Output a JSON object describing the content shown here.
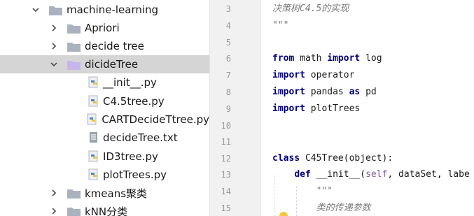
{
  "project_tree": {
    "items": [
      {
        "label": "machine-learning",
        "expanded": true,
        "type": "folder"
      },
      {
        "label": "Apriori",
        "expanded": false,
        "type": "folder"
      },
      {
        "label": "decide tree",
        "expanded": false,
        "type": "folder"
      },
      {
        "label": "dicideTree",
        "expanded": true,
        "type": "folder",
        "selected": true
      },
      {
        "label": "__init__.py",
        "type": "python-file"
      },
      {
        "label": "C4.5tree.py",
        "type": "python-file"
      },
      {
        "label": "CARTDecideTtree.py",
        "type": "python-file"
      },
      {
        "label": "decideTree.txt",
        "type": "text-file"
      },
      {
        "label": "ID3tree.py",
        "type": "python-file"
      },
      {
        "label": "plotTrees.py",
        "type": "python-file"
      },
      {
        "label": "kmeans聚类",
        "expanded": false,
        "type": "folder"
      },
      {
        "label": "kNN分类",
        "expanded": false,
        "type": "folder"
      }
    ]
  },
  "editor": {
    "line_numbers": [
      "3",
      "4",
      "5",
      "6",
      "7",
      "8",
      "9",
      "10",
      "11",
      "12",
      "13",
      "14",
      "15"
    ],
    "lines": [
      {
        "n": "3",
        "parts": [
          {
            "t": "决策树C4.5的实现",
            "s": "doc"
          }
        ]
      },
      {
        "n": "4",
        "parts": [
          {
            "t": "\"\"\"",
            "s": "doc"
          }
        ]
      },
      {
        "n": "5",
        "parts": []
      },
      {
        "n": "6",
        "parts": [
          {
            "t": "from",
            "s": "kw"
          },
          {
            "t": " math ",
            "s": ""
          },
          {
            "t": "import",
            "s": "kw"
          },
          {
            "t": " log",
            "s": ""
          }
        ]
      },
      {
        "n": "7",
        "parts": [
          {
            "t": "import",
            "s": "kw"
          },
          {
            "t": " operator",
            "s": ""
          }
        ]
      },
      {
        "n": "8",
        "parts": [
          {
            "t": "import",
            "s": "kw"
          },
          {
            "t": " pandas ",
            "s": ""
          },
          {
            "t": "as",
            "s": "kw"
          },
          {
            "t": " pd",
            "s": ""
          }
        ]
      },
      {
        "n": "9",
        "parts": [
          {
            "t": "import",
            "s": "kw"
          },
          {
            "t": " plotTrees",
            "s": ""
          }
        ]
      },
      {
        "n": "10",
        "parts": []
      },
      {
        "n": "11",
        "parts": []
      },
      {
        "n": "12",
        "parts": [
          {
            "t": "class",
            "s": "kw"
          },
          {
            "t": " C45Tree(object):",
            "s": ""
          }
        ]
      },
      {
        "n": "13",
        "parts": [
          {
            "t": "    ",
            "s": ""
          },
          {
            "t": "def",
            "s": "kw"
          },
          {
            "t": " __init__(",
            "s": ""
          },
          {
            "t": "self",
            "s": "slf"
          },
          {
            "t": ", dataSet, labe",
            "s": ""
          }
        ]
      },
      {
        "n": "14",
        "parts": [
          {
            "t": "        ",
            "s": ""
          },
          {
            "t": "\"\"\"",
            "s": "doc"
          }
        ]
      },
      {
        "n": "15",
        "parts": [
          {
            "t": "        ",
            "s": ""
          },
          {
            "t": "类的传递参数",
            "s": "doc"
          }
        ]
      }
    ]
  },
  "colors": {
    "folder": "#a9b2bd",
    "folder_selected": "#c6b5ea",
    "keyword": "#000080",
    "docstring": "#7a7a7a",
    "gutter_bg": "#f1f1f1",
    "selection_bg": "#d5d5d5"
  }
}
